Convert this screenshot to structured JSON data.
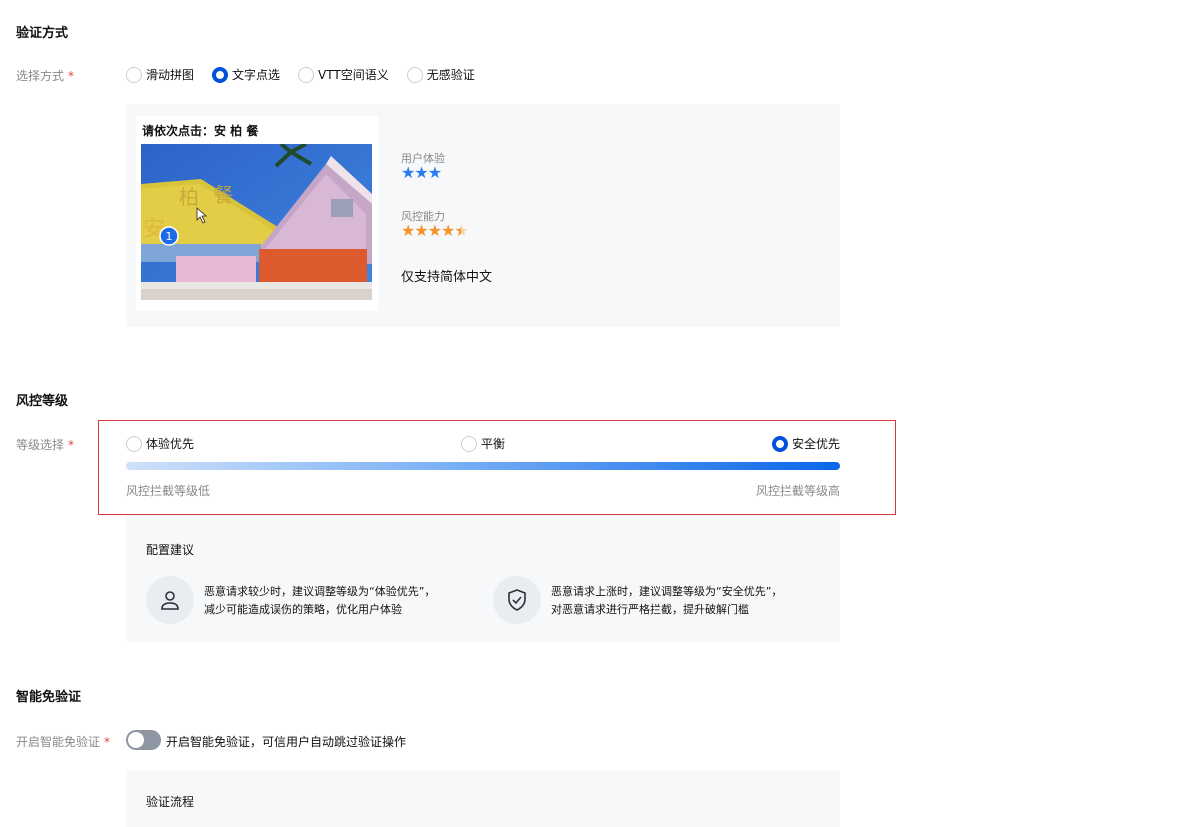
{
  "verify": {
    "section_title": "验证方式",
    "label": "选择方式",
    "required_mark": "*",
    "options": [
      {
        "label": "滑动拼图",
        "selected": false
      },
      {
        "label": "文字点选",
        "selected": true
      },
      {
        "label": "VTT空间语义",
        "selected": false
      },
      {
        "label": "无感验证",
        "selected": false
      }
    ],
    "preview": {
      "prompt": "请依次点击：安 柏 餐",
      "click_order_badge": "1",
      "overlay_chars": [
        "柏",
        "餐",
        "安"
      ],
      "ux_label": "用户体验",
      "ux_stars": "★★★",
      "risk_label": "风控能力",
      "risk_stars": "★★★★",
      "risk_half_star": "★",
      "note": "仅支持简体中文",
      "star_colors": {
        "ux": "#2b7cf0",
        "risk": "#f5922b"
      }
    }
  },
  "risk": {
    "section_title": "风控等级",
    "label": "等级选择",
    "required_mark": "*",
    "options": [
      {
        "label": "体验优先",
        "selected": false
      },
      {
        "label": "平衡",
        "selected": false
      },
      {
        "label": "安全优先",
        "selected": true
      }
    ],
    "low_caption": "风控拦截等级低",
    "high_caption": "风控拦截等级高"
  },
  "advice": {
    "title": "配置建议",
    "items": [
      {
        "icon": "user-icon",
        "line1": "恶意请求较少时，建议调整等级为“体验优先”，",
        "line2": "减少可能造成误伤的策略，优化用户体验"
      },
      {
        "icon": "shield-check-icon",
        "line1": "恶意请求上涨时，建议调整等级为“安全优先”，",
        "line2": "对恶意请求进行严格拦截，提升破解门槛"
      }
    ]
  },
  "smart": {
    "section_title": "智能免验证",
    "label": "开启智能免验证",
    "required_mark": "*",
    "toggle_on": false,
    "toggle_text": "开启智能免验证，可信用户自动跳过验证操作",
    "flow_title": "验证流程"
  },
  "colors": {
    "accent": "#0052d9",
    "required": "#e54545",
    "highlight_border": "#d9363e"
  }
}
